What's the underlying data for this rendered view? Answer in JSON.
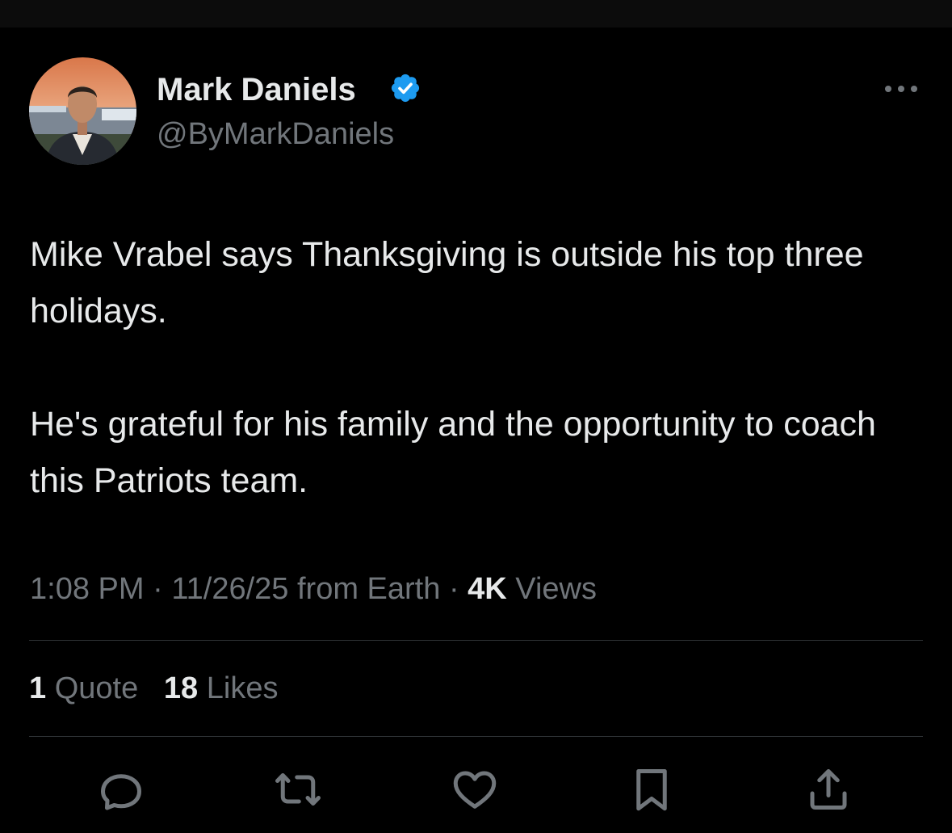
{
  "author": {
    "display_name": "Mark Daniels",
    "handle": "@ByMarkDaniels",
    "verified_icon": "verified-badge-icon",
    "verified_color": "#1d9bf0"
  },
  "tweet": {
    "paragraphs": [
      "Mike Vrabel says Thanksgiving is outside his top three holidays.",
      "He's grateful for his family and the opportunity to coach this Patriots team."
    ]
  },
  "meta": {
    "time": "1:08 PM",
    "date": "11/26/25",
    "source": "from Earth",
    "separator": "·",
    "views_count": "4K",
    "views_label": "Views"
  },
  "stats": {
    "quotes_count": "1",
    "quotes_label": "Quote",
    "likes_count": "18",
    "likes_label": "Likes"
  },
  "actions": [
    {
      "icon": "reply-icon"
    },
    {
      "icon": "retweet-icon"
    },
    {
      "icon": "like-heart-icon"
    },
    {
      "icon": "bookmark-icon"
    },
    {
      "icon": "share-icon"
    }
  ],
  "colors": {
    "background": "#000000",
    "text_primary": "#e7e9ea",
    "text_secondary": "#71767b",
    "divider": "#2f3336"
  }
}
